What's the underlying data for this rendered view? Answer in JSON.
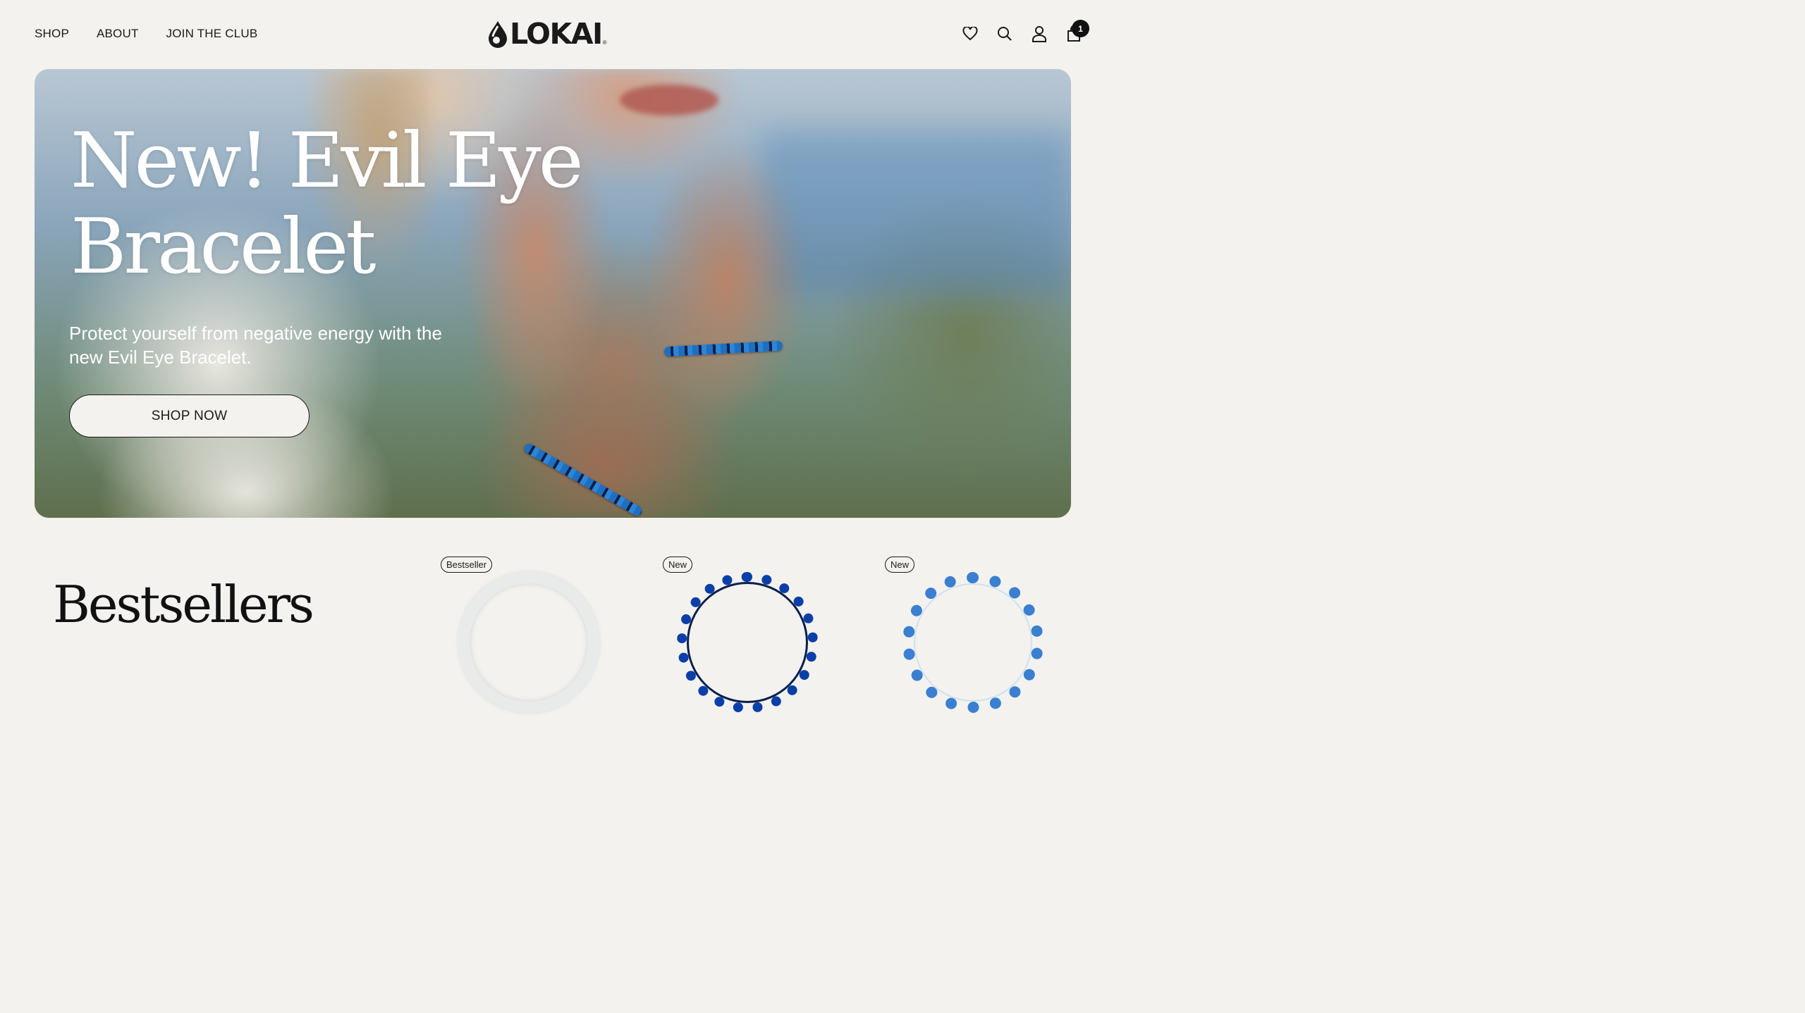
{
  "header": {
    "nav": [
      {
        "label": "SHOP"
      },
      {
        "label": "ABOUT"
      },
      {
        "label": "JOIN THE CLUB"
      }
    ],
    "logo": {
      "text": "LOKAI",
      "mark": "®"
    },
    "icons": [
      "heart-icon",
      "search-icon",
      "user-icon",
      "cart-icon"
    ],
    "cart_count": "1"
  },
  "hero": {
    "title_line1": "New! Evil Eye",
    "title_line2": "Bracelet",
    "subtitle": "Protect yourself from negative energy with the new Evil Eye Bracelet.",
    "cta_label": "SHOP NOW"
  },
  "bestsellers": {
    "title": "Bestsellers",
    "products": [
      {
        "badge": "Bestseller"
      },
      {
        "badge": "New"
      },
      {
        "badge": "New"
      }
    ]
  },
  "colors": {
    "background": "#f3f2ee",
    "text": "#161616",
    "hero_text": "#ffffff"
  }
}
